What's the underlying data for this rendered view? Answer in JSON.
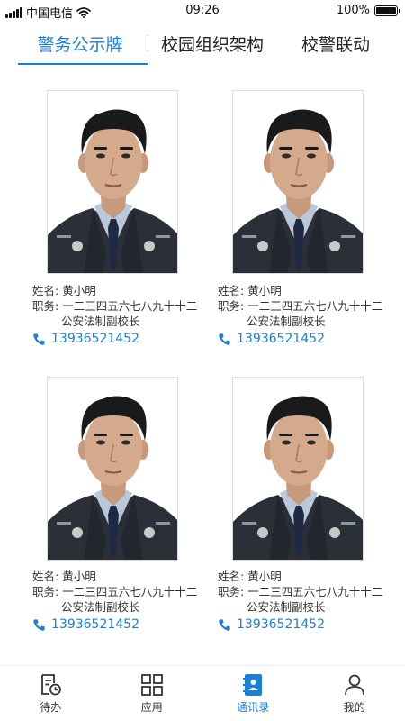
{
  "status_bar": {
    "carrier": "中国电信",
    "time": "09:26",
    "battery": "100%",
    "battery_level": 1.0
  },
  "tabs": [
    {
      "label": "警务公示牌",
      "active": true
    },
    {
      "label": "校园组织架构",
      "active": false
    },
    {
      "label": "校警联动",
      "active": false
    }
  ],
  "cards": [
    {
      "name_label": "姓名:",
      "name": "黄小明",
      "duty_label": "职务:",
      "duty_line1": "一二三四五六七八九十十二",
      "duty_line2": "公安法制副校长",
      "phone": "13936521452"
    },
    {
      "name_label": "姓名:",
      "name": "黄小明",
      "duty_label": "职务:",
      "duty_line1": "一二三四五六七八九十十二",
      "duty_line2": "公安法制副校长",
      "phone": "13936521452"
    },
    {
      "name_label": "姓名:",
      "name": "黄小明",
      "duty_label": "职务:",
      "duty_line1": "一二三四五六七八九十十二",
      "duty_line2": "公安法制副校长",
      "phone": "13936521452"
    },
    {
      "name_label": "姓名:",
      "name": "黄小明",
      "duty_label": "职务:",
      "duty_line1": "一二三四五六七八九十十二",
      "duty_line2": "公安法制副校长",
      "phone": "13936521452"
    }
  ],
  "bottom_nav": [
    {
      "label": "待办",
      "icon": "todo-icon",
      "active": false
    },
    {
      "label": "应用",
      "icon": "apps-grid-icon",
      "active": false
    },
    {
      "label": "通讯录",
      "icon": "contacts-icon",
      "active": true
    },
    {
      "label": "我的",
      "icon": "profile-icon",
      "active": false
    }
  ],
  "colors": {
    "accent": "#1b7fd6",
    "uniform": "#2a2f38",
    "shirt": "#b9c8da",
    "tie": "#1e2a44"
  }
}
